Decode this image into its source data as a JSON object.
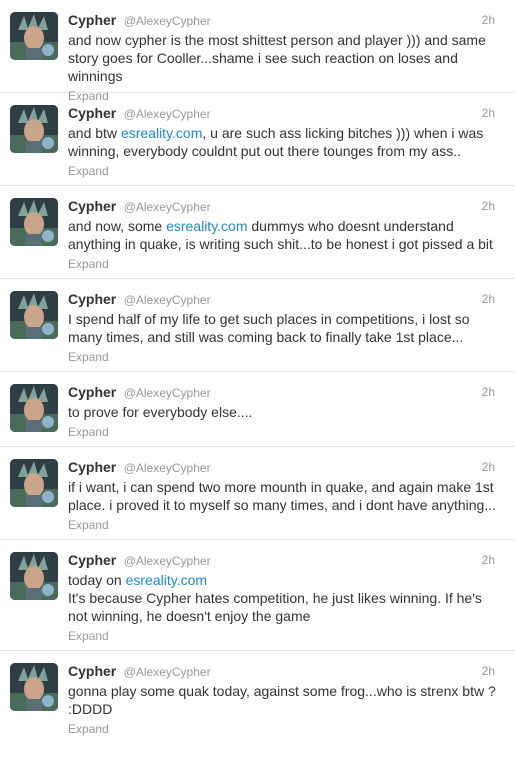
{
  "user": {
    "name": "Cypher",
    "handle": "@AlexeyCypher"
  },
  "expand_label": "Expand",
  "link_color": "#1f8ac8",
  "tweets": [
    {
      "time": "2h",
      "parts": [
        "and now cypher is the most shittest person and player ))) and same story goes for Cooller...shame i see such reaction on loses and winnings"
      ]
    },
    {
      "time": "2h",
      "parts": [
        "and btw ",
        "esreality.com",
        ", u are such ass licking bitches ))) when i was winning, everybody couldnt put out there tounges from my ass.."
      ]
    },
    {
      "time": "2h",
      "parts": [
        "and now, some ",
        "esreality.com",
        " dummys who doesnt understand anything in quake, is writing such shit...to be honest i got pissed a bit"
      ]
    },
    {
      "time": "2h",
      "parts": [
        "I spend half of my life to get such places in competitions, i lost so many times, and still was coming back to finally take 1st place..."
      ]
    },
    {
      "time": "2h",
      "parts": [
        "to prove for everybody else...."
      ]
    },
    {
      "time": "2h",
      "parts": [
        "if i want, i can spend two more mounth in quake, and again make 1st place. i proved it to myself so many times, and i dont have anything..."
      ]
    },
    {
      "time": "2h",
      "parts": [
        "today on ",
        "esreality.com",
        "\nIt's because Cypher hates competition, he just likes winning. If he's not winning, he doesn't enjoy the game"
      ]
    },
    {
      "time": "2h",
      "parts": [
        "gonna play some quak today, against some frog...who is strenx btw ?\n:DDDD"
      ]
    }
  ]
}
